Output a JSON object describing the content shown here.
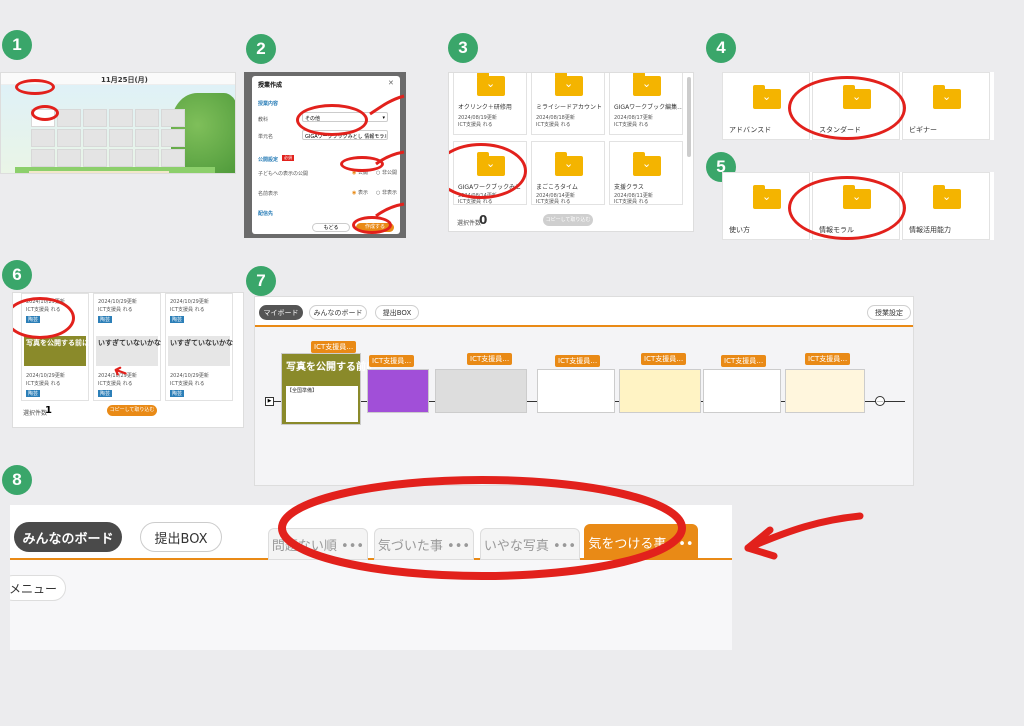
{
  "steps": [
    "1",
    "2",
    "3",
    "4",
    "5",
    "6",
    "7",
    "8"
  ],
  "panel1": {
    "date": "11月25日(月)"
  },
  "panel2": {
    "title": "授業作成",
    "section_content": "授業内容",
    "subject_label": "教科",
    "subject_value": "その他",
    "unit_label": "単元名",
    "unit_value": "GIGAワークブックみとし 情報モラル",
    "section_publish": "公開設定",
    "required_badge": "必須",
    "publish_label": "子どもへの表示の公開",
    "public_option": "公開",
    "private_option": "非公開",
    "display_label": "名前表示",
    "show_option": "表示",
    "hide_option": "非表示",
    "section_dest": "配信先",
    "back_button": "もどる",
    "create_button": "作成する"
  },
  "panel3": {
    "folders": [
      {
        "name": "オクリンク＋研修用",
        "date": "2024/08/19更新",
        "owner": "ICT支援員 れる"
      },
      {
        "name": "ミライシードアカウント",
        "date": "2024/08/18更新",
        "owner": "ICT支援員 れる"
      },
      {
        "name": "GIGAワークブック編集…",
        "date": "2024/08/17更新",
        "owner": "ICT支援員 れる"
      },
      {
        "name": "GIGAワークブックみと",
        "date": "2024/08/14更新",
        "owner": "ICT支援員 れる"
      },
      {
        "name": "まごころタイム",
        "date": "2024/08/14更新",
        "owner": "ICT支援員 れる"
      },
      {
        "name": "支援クラス",
        "date": "2024/08/11更新",
        "owner": "ICT支援員 れる"
      }
    ],
    "selected_label": "選択件数",
    "selected_count": "0",
    "copy_button": "コピーして取り込む"
  },
  "panel4": {
    "folders": [
      "アドバンスド",
      "スタンダード",
      "ビギナー"
    ]
  },
  "panel5": {
    "folders": [
      "使い方",
      "情報モラル",
      "情報活用能力"
    ]
  },
  "panel6": {
    "cards": [
      {
        "date": "2024/10/29更新",
        "owner": "ICT支援員 れる",
        "tag": "陶芸"
      },
      {
        "date": "2024/10/29更新",
        "owner": "ICT支援員 れる",
        "tag": "陶芸"
      },
      {
        "date": "2024/10/29更新",
        "owner": "ICT支援員 れる",
        "tag": "陶芸"
      }
    ],
    "slide_titles": [
      "写真を公開する前に",
      "いすぎていないかな",
      "いすぎていないかな"
    ],
    "selected_label": "選択件数",
    "selected_count": "1",
    "copy_button": "コピーして取り込む"
  },
  "panel7": {
    "tabs": [
      "マイボード",
      "みんなのボード",
      "提出BOX"
    ],
    "settings_button": "授業設定",
    "card_tag": "ICT支援員…",
    "first_card_title": "写真を公開する前に",
    "first_card_sub": "【全国準備】"
  },
  "panel8": {
    "tabs": [
      "みんなのボード",
      "提出BOX"
    ],
    "board_tabs": [
      "問題ない順 •••",
      "気づいた事 •••",
      "いやな写真 •••",
      "気をつける事 •••"
    ],
    "menu_button": "メニュー"
  },
  "colors": {
    "accent": "#e98a16",
    "badge": "#3aa66a",
    "annotation": "#e2211c",
    "folder": "#f4b400"
  }
}
